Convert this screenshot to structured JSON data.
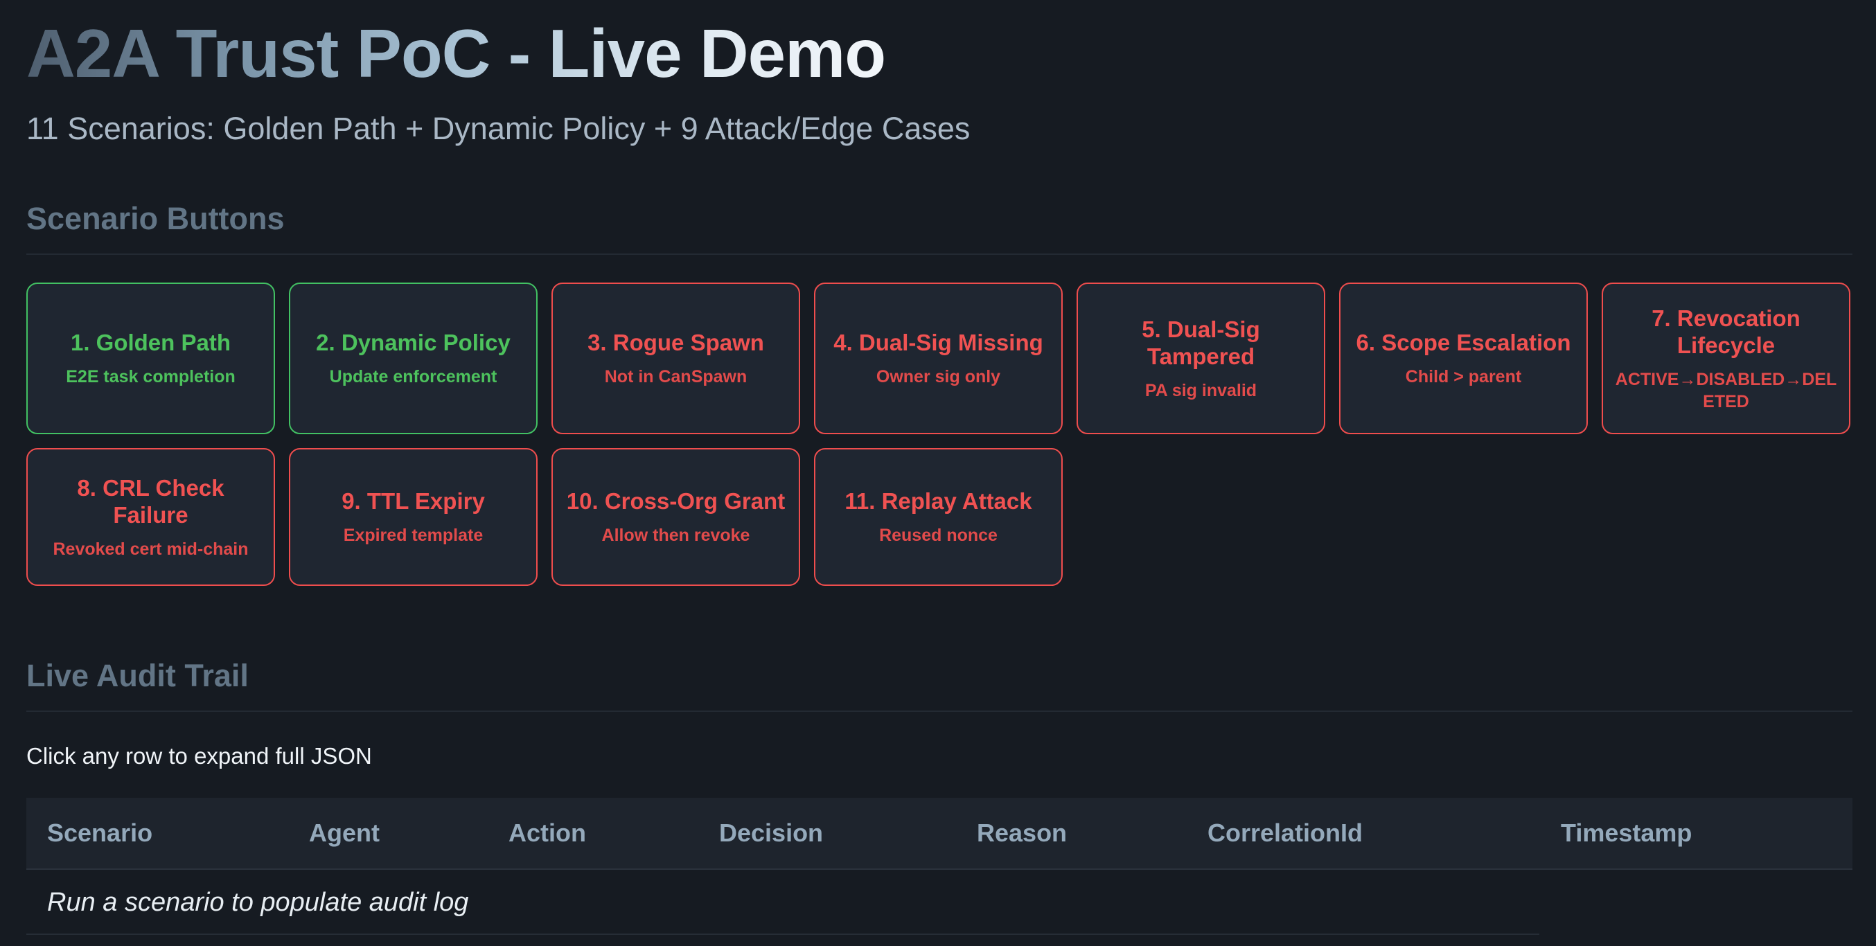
{
  "header": {
    "title": "A2A Trust PoC - Live Demo",
    "subtitle": "11 Scenarios: Golden Path + Dynamic Policy + 9 Attack/Edge Cases"
  },
  "scenario_section": {
    "heading": "Scenario Buttons",
    "buttons": [
      {
        "title": "1. Golden Path",
        "sub": "E2E task completion",
        "status": "success"
      },
      {
        "title": "2. Dynamic Policy",
        "sub": "Update enforcement",
        "status": "success"
      },
      {
        "title": "3. Rogue Spawn",
        "sub": "Not in CanSpawn",
        "status": "attack"
      },
      {
        "title": "4. Dual-Sig Missing",
        "sub": "Owner sig only",
        "status": "attack"
      },
      {
        "title": "5. Dual-Sig Tampered",
        "sub": "PA sig invalid",
        "status": "attack"
      },
      {
        "title": "6. Scope Escalation",
        "sub": "Child > parent",
        "status": "attack"
      },
      {
        "title": "7. Revocation Lifecycle",
        "sub": "ACTIVE→DISABLED→DELETED",
        "status": "attack"
      },
      {
        "title": "8. CRL Check Failure",
        "sub": "Revoked cert mid-chain",
        "status": "attack"
      },
      {
        "title": "9. TTL Expiry",
        "sub": "Expired template",
        "status": "attack"
      },
      {
        "title": "10. Cross-Org Grant",
        "sub": "Allow then revoke",
        "status": "attack"
      },
      {
        "title": "11. Replay Attack",
        "sub": "Reused nonce",
        "status": "attack"
      }
    ]
  },
  "audit_section": {
    "heading": "Live Audit Trail",
    "hint": "Click any row to expand full JSON",
    "columns": [
      "Scenario",
      "Agent",
      "Action",
      "Decision",
      "Reason",
      "CorrelationId",
      "Timestamp"
    ],
    "empty_message": "Run a scenario to populate audit log"
  },
  "colors": {
    "background": "#161b22",
    "card": "#1f2631",
    "success": "#42c163",
    "attack": "#ef4d4d",
    "section_heading": "#627586"
  }
}
